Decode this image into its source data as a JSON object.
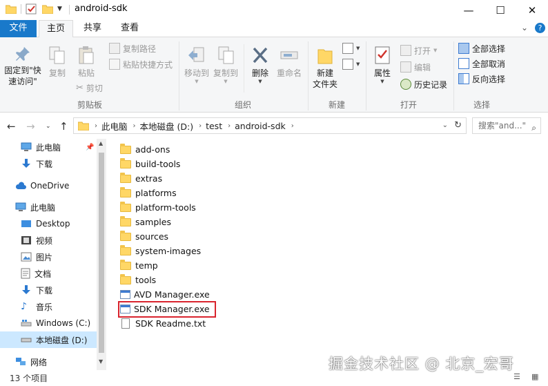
{
  "window": {
    "title": "android-sdk",
    "minimize": "—",
    "maximize": "☐",
    "close": "✕"
  },
  "tabs": {
    "file": "文件",
    "home": "主页",
    "share": "共享",
    "view": "查看"
  },
  "ribbon": {
    "clipboard": {
      "label": "剪贴板",
      "pin": "固定到\"快\n速访问\"",
      "copy": "复制",
      "paste": "粘贴",
      "copy_path": "复制路径",
      "paste_shortcut": "粘贴快捷方式",
      "cut": "剪切"
    },
    "organize": {
      "label": "组织",
      "move_to": "移动到",
      "copy_to": "复制到",
      "delete": "删除",
      "rename": "重命名"
    },
    "new": {
      "label": "新建",
      "new_folder": "新建\n文件夹"
    },
    "open": {
      "label": "打开",
      "properties": "属性",
      "open": "打开",
      "edit": "编辑",
      "history": "历史记录"
    },
    "select": {
      "label": "选择",
      "select_all": "全部选择",
      "select_none": "全部取消",
      "invert": "反向选择"
    }
  },
  "address": {
    "crumbs": [
      "此电脑",
      "本地磁盘 (D:)",
      "test",
      "android-sdk"
    ],
    "search_placeholder": "搜索\"and...\""
  },
  "nav": [
    {
      "label": "此电脑",
      "icon": "pc-icon"
    },
    {
      "label": "下载",
      "icon": "download-icon"
    },
    {
      "label": "OneDrive",
      "icon": "cloud-icon"
    },
    {
      "label": "此电脑",
      "icon": "pc-icon"
    },
    {
      "label": "Desktop",
      "icon": "desktop-icon"
    },
    {
      "label": "视频",
      "icon": "video-icon"
    },
    {
      "label": "图片",
      "icon": "picture-icon"
    },
    {
      "label": "文档",
      "icon": "document-icon"
    },
    {
      "label": "下载",
      "icon": "download-icon"
    },
    {
      "label": "音乐",
      "icon": "music-icon"
    },
    {
      "label": "Windows (C:)",
      "icon": "drive-icon"
    },
    {
      "label": "本地磁盘 (D:)",
      "icon": "drive-icon"
    },
    {
      "label": "网络",
      "icon": "network-icon"
    }
  ],
  "files": [
    {
      "name": "add-ons",
      "type": "folder"
    },
    {
      "name": "build-tools",
      "type": "folder"
    },
    {
      "name": "extras",
      "type": "folder"
    },
    {
      "name": "platforms",
      "type": "folder"
    },
    {
      "name": "platform-tools",
      "type": "folder"
    },
    {
      "name": "samples",
      "type": "folder"
    },
    {
      "name": "sources",
      "type": "folder"
    },
    {
      "name": "system-images",
      "type": "folder"
    },
    {
      "name": "temp",
      "type": "folder"
    },
    {
      "name": "tools",
      "type": "folder"
    },
    {
      "name": "AVD Manager.exe",
      "type": "exe"
    },
    {
      "name": "SDK Manager.exe",
      "type": "exe"
    },
    {
      "name": "SDK Readme.txt",
      "type": "txt"
    }
  ],
  "status": {
    "count": "13 个项目"
  },
  "watermark": "掘金技术社区 @ 北京_宏哥",
  "colors": {
    "accent": "#1979ca",
    "highlight_box": "#d9232d",
    "selected_nav": "#cce8ff"
  }
}
